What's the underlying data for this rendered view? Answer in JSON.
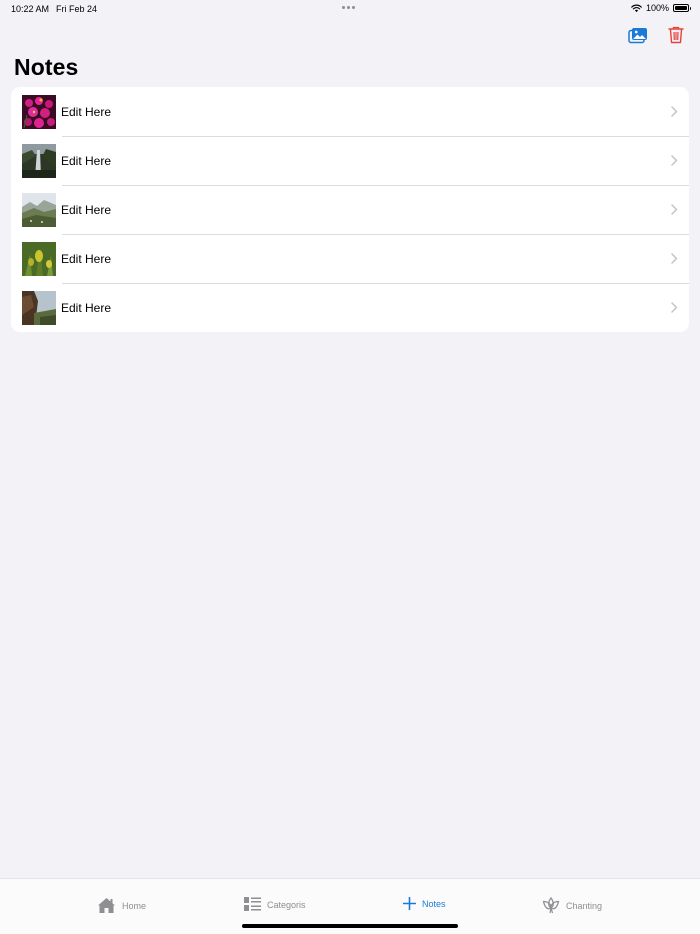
{
  "status_bar": {
    "time": "10:22 AM",
    "date": "Fri Feb 24",
    "battery": "100%"
  },
  "toolbar": {
    "photo_button_icon": "photo-library-icon",
    "delete_button_icon": "trash-icon",
    "accent_color": "#1a7bd6",
    "destructive_color": "#e8413b"
  },
  "page": {
    "title": "Notes"
  },
  "notes": [
    {
      "label": "Edit Here",
      "thumbnail": "pink flowers"
    },
    {
      "label": "Edit Here",
      "thumbnail": "waterfall"
    },
    {
      "label": "Edit Here",
      "thumbnail": "mountain valley"
    },
    {
      "label": "Edit Here",
      "thumbnail": "yellow flowers"
    },
    {
      "label": "Edit Here",
      "thumbnail": "cliff landscape"
    }
  ],
  "tab_bar": {
    "tabs": [
      {
        "label": "Home",
        "icon": "house-icon",
        "active": false
      },
      {
        "label": "Categoris",
        "icon": "list-icon",
        "active": false
      },
      {
        "label": "Notes",
        "icon": "plus-icon",
        "active": true
      },
      {
        "label": "Chanting",
        "icon": "triquetra-icon",
        "active": false
      }
    ]
  }
}
